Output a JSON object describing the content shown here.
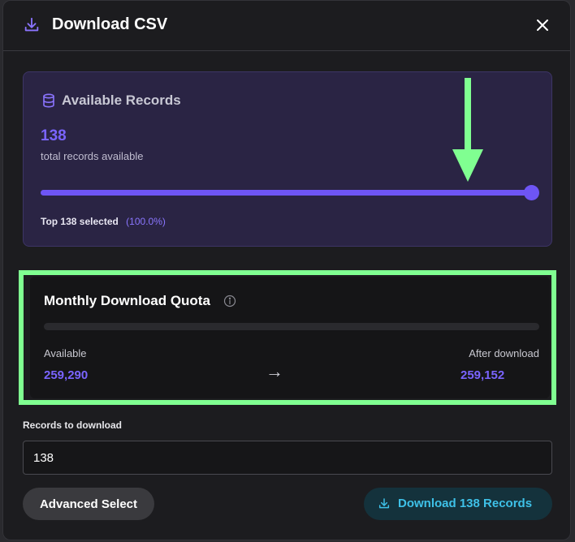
{
  "dialog": {
    "title": "Download CSV",
    "icon": "download-icon",
    "close_icon": "close-icon"
  },
  "records": {
    "title": "Available Records",
    "icon": "database-icon",
    "count": "138",
    "subtitle": "total records available",
    "slider_fraction": 1.0,
    "selected_text": "Top 138 selected",
    "selected_percent": "(100.0%)"
  },
  "quota": {
    "title": "Monthly Download Quota",
    "info_icon": "info-icon",
    "used_fraction": 0.0,
    "available_label": "Available",
    "available_value": "259,290",
    "arrow": "→",
    "after_label": "After download",
    "after_value": "259,152"
  },
  "form": {
    "records_label": "Records to download",
    "records_value": "138"
  },
  "actions": {
    "advanced_label": "Advanced Select",
    "download_label": "Download 138 Records"
  },
  "colors": {
    "accent": "#6e55f5",
    "annotation": "#80ff91",
    "download_text": "#3ec1e8"
  }
}
